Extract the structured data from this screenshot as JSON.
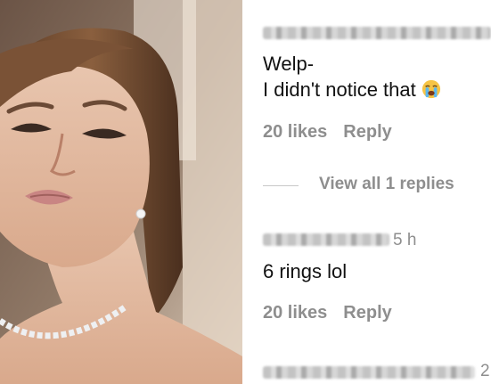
{
  "comments": [
    {
      "username": "",
      "text_lines": [
        "Welp-",
        "I didn't notice that"
      ],
      "emoji_icon": "loudly-crying-face-icon",
      "likes": "20 likes",
      "reply_label": "Reply"
    },
    {
      "username": "",
      "timestamp": "5 h",
      "text": "6 rings lol",
      "likes": "20 likes",
      "reply_label": "Reply"
    }
  ],
  "view_replies": "View all 1 replies",
  "third_comment_timestamp_fragment": "2"
}
